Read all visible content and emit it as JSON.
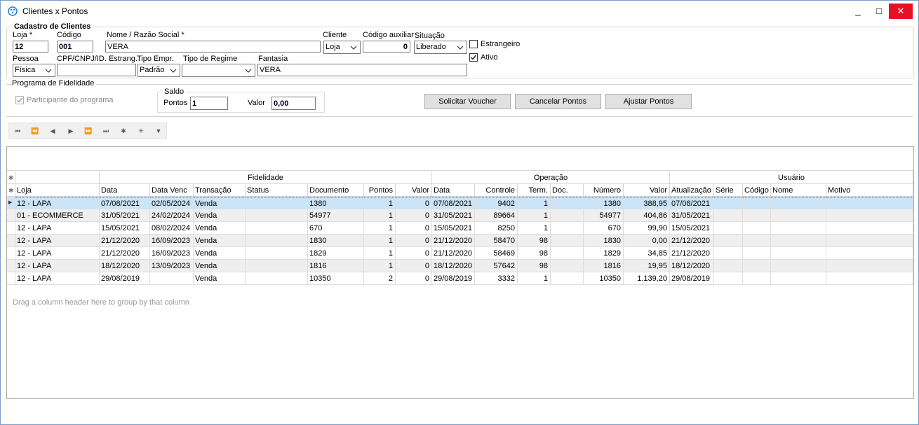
{
  "window": {
    "title": "Clientes x Pontos",
    "minimize": "_",
    "maximize": "□",
    "close": "✕"
  },
  "cadastro": {
    "group_title": "Cadastro de Clientes",
    "loja_label": "Loja *",
    "loja_value": "12",
    "codigo_label": "Código",
    "codigo_value": "001",
    "nome_label": "Nome / Razão Social *",
    "nome_value": "VERA",
    "cliente_label": "Cliente",
    "cliente_value": "Loja",
    "codaux_label": "Código auxiliar",
    "codaux_value": "0",
    "situacao_label": "Situação",
    "situacao_value": "Liberado",
    "estrangeiro_label": "Estrangeiro",
    "ativo_label": "Ativo",
    "pessoa_label": "Pessoa",
    "pessoa_value": "Física",
    "cpf_label": "CPF/CNPJ/ID. Estrang.",
    "cpf_value": "",
    "tipoempr_label": "Tipo Empr.",
    "tipoempr_value": "Padrão",
    "regime_label": "Tipo de Regime",
    "regime_value": "",
    "fantasia_label": "Fantasia",
    "fantasia_value": "VERA"
  },
  "fidelidade": {
    "group_title": "Programa de Fidelidade",
    "participante_label": "Participante do programa",
    "saldo_label": "Saldo",
    "pontos_label": "Pontos",
    "pontos_value": "1",
    "valor_label": "Valor",
    "valor_value": "0,00",
    "btn_solicitar": "Solicitar Voucher",
    "btn_cancelar": "Cancelar Pontos",
    "btn_ajustar": "Ajustar Pontos"
  },
  "grid": {
    "group_hint": "Drag a column header here to group by that column",
    "bands": [
      "Fidelidade",
      "Operação",
      "Usuário"
    ],
    "columns": [
      "Loja",
      "Data",
      "Data Venc",
      "Transação",
      "Status",
      "Documento",
      "Pontos",
      "Valor",
      "Data",
      "Controle",
      "Term.",
      "Doc.",
      "Número",
      "Valor",
      "Atualização",
      "Série",
      "Código",
      "Nome",
      "Motivo"
    ],
    "rows": [
      [
        "12 - LAPA",
        "07/08/2021",
        "02/05/2024",
        "Venda",
        "",
        "1380",
        "1",
        "0",
        "07/08/2021",
        "9402",
        "1",
        "",
        "1380",
        "388,95",
        "07/08/2021",
        "",
        "",
        "",
        ""
      ],
      [
        "01 - ECOMMERCE",
        "31/05/2021",
        "24/02/2024",
        "Venda",
        "",
        "54977",
        "1",
        "0",
        "31/05/2021",
        "89664",
        "1",
        "",
        "54977",
        "404,86",
        "31/05/2021",
        "",
        "",
        "",
        ""
      ],
      [
        "12 - LAPA",
        "15/05/2021",
        "08/02/2024",
        "Venda",
        "",
        "670",
        "1",
        "0",
        "15/05/2021",
        "8250",
        "1",
        "",
        "670",
        "99,90",
        "15/05/2021",
        "",
        "",
        "",
        ""
      ],
      [
        "12 - LAPA",
        "21/12/2020",
        "16/09/2023",
        "Venda",
        "",
        "1830",
        "1",
        "0",
        "21/12/2020",
        "58470",
        "98",
        "",
        "1830",
        "0,00",
        "21/12/2020",
        "",
        "",
        "",
        ""
      ],
      [
        "12 - LAPA",
        "21/12/2020",
        "16/09/2023",
        "Venda",
        "",
        "1829",
        "1",
        "0",
        "21/12/2020",
        "58469",
        "98",
        "",
        "1829",
        "34,85",
        "21/12/2020",
        "",
        "",
        "",
        ""
      ],
      [
        "12 - LAPA",
        "18/12/2020",
        "13/09/2023",
        "Venda",
        "",
        "1816",
        "1",
        "0",
        "18/12/2020",
        "57642",
        "98",
        "",
        "1816",
        "19,95",
        "18/12/2020",
        "",
        "",
        "",
        ""
      ],
      [
        "12 - LAPA",
        "29/08/2019",
        "",
        "Venda",
        "",
        "10350",
        "2",
        "0",
        "29/08/2019",
        "3332",
        "1",
        "",
        "10350",
        "1.139,20",
        "29/08/2019",
        "",
        "",
        "",
        ""
      ]
    ],
    "selected_row": 0
  },
  "colors": {
    "accent": "#0078d7",
    "selected_row": "#cce4f7",
    "alt_row": "#efefef",
    "close": "#e81123"
  }
}
